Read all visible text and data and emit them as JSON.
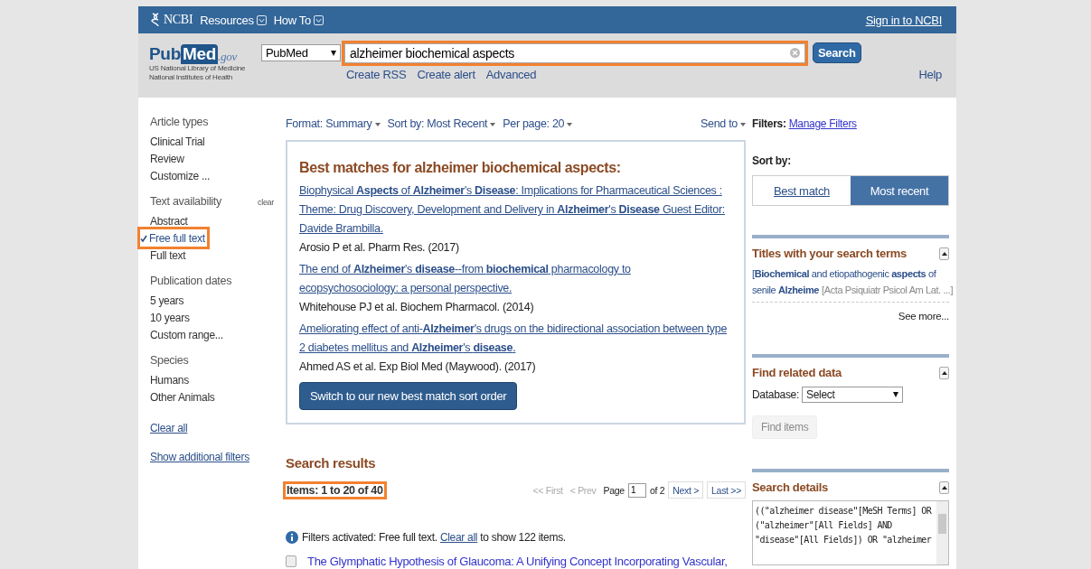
{
  "header": {
    "logo": "NCBI",
    "menus": [
      {
        "label": "Resources"
      },
      {
        "label": "How To"
      }
    ],
    "sign_in": "Sign in to NCBI"
  },
  "search_bar": {
    "logo_pub": "Pub",
    "logo_med": "Med",
    "logo_gov": ".gov",
    "org_lines": [
      "US National Library of Medicine",
      "National Institutes of Health"
    ],
    "database": "PubMed",
    "query": "alzheimer biochemical aspects",
    "highlighted": true,
    "search_button": "Search",
    "links": [
      "Create RSS",
      "Create alert",
      "Advanced"
    ],
    "help": "Help"
  },
  "sidebar": {
    "groups": [
      {
        "title": "Article types",
        "items": [
          {
            "label": "Clinical Trial",
            "checked": false,
            "highlighted": false
          },
          {
            "label": "Review",
            "checked": false,
            "highlighted": false
          },
          {
            "label": "Customize ...",
            "checked": false,
            "highlighted": false
          }
        ]
      },
      {
        "title": "Text availability",
        "clear": "clear",
        "items": [
          {
            "label": "Abstract",
            "checked": false,
            "highlighted": false
          },
          {
            "label": "Free full text",
            "checked": true,
            "highlighted": true
          },
          {
            "label": "Full text",
            "checked": false,
            "highlighted": false
          }
        ]
      },
      {
        "title": "Publication dates",
        "items": [
          {
            "label": "5 years",
            "checked": false,
            "highlighted": false
          },
          {
            "label": "10 years",
            "checked": false,
            "highlighted": false
          },
          {
            "label": "Custom range...",
            "checked": false,
            "highlighted": false
          }
        ]
      },
      {
        "title": "Species",
        "items": [
          {
            "label": "Humans",
            "checked": false,
            "highlighted": false
          },
          {
            "label": "Other Animals",
            "checked": false,
            "highlighted": false
          }
        ]
      }
    ],
    "links": [
      "Clear all",
      "Show additional filters"
    ]
  },
  "toolbar": {
    "menus": [
      {
        "label": "Format: Summary"
      },
      {
        "label": "Sort by: Most Recent"
      },
      {
        "label": "Per page: 20"
      }
    ],
    "send_to": "Send to"
  },
  "best_matches": {
    "title": "Best matches for alzheimer biochemical aspects:",
    "results": [
      {
        "title": "Biophysical **Aspects** of **Alzheimer**'s **Disease**: Implications for Pharmaceutical Sciences : Theme: Drug Discovery, Development and Delivery in **Alzheimer**'s **Disease** Guest Editor: Davide Brambilla.",
        "citation": "Arosio P et al. Pharm Res. (2017)"
      },
      {
        "title": "The end of **Alzheimer**'s **disease**--from **biochemical** pharmacology to ecopsychosociology: a personal perspective.",
        "citation": "Whitehouse PJ et al. Biochem Pharmacol. (2014)"
      },
      {
        "title": "Ameliorating effect of anti-**Alzheimer**'s drugs on the bidirectional association between type 2 diabetes mellitus and **Alzheimer**'s **disease**.",
        "citation": "Ahmed AS et al. Exp Biol Med (Maywood). (2017)"
      }
    ],
    "button": "Switch to our new best match sort order"
  },
  "search_results": {
    "title": "Search results",
    "count": "Items: 1 to 20 of 40",
    "count_highlighted": true,
    "pager": {
      "first": {
        "label": "<< First",
        "disabled": true
      },
      "prev": {
        "label": "< Prev",
        "disabled": true
      },
      "page_label": "Page",
      "page": "1",
      "of": "of 2",
      "next": {
        "label": "Next >",
        "disabled": false
      },
      "last": {
        "label": "Last >>",
        "disabled": false
      }
    },
    "notice": {
      "before": "Filters activated: Free full text.",
      "link": "Clear all",
      "after": "to show 122 items."
    },
    "results": [
      {
        "title": "The Glymphatic Hypothesis of Glaucoma: A Unifying Concept Incorporating Vascular,",
        "checked": false
      }
    ]
  },
  "right": {
    "filters_label": "Filters:",
    "manage_filters": "Manage Filters",
    "sort_label": "Sort by:",
    "sort_options": [
      {
        "label": "Best match",
        "selected": false
      },
      {
        "label": "Most recent",
        "selected": true
      }
    ],
    "titles_panel": {
      "heading": "Titles with your search terms",
      "entry_lines": [
        "[**Biochemical** and etiopathogenic **aspects** of",
        "senile **Alzheime**"
      ],
      "source": "[Acta Psiquiatr Psicol Am Lat. ...]",
      "see_more": "See more..."
    },
    "related_panel": {
      "heading": "Find related data",
      "database_label": "Database:",
      "database_value": "Select",
      "button": {
        "label": "Find items",
        "disabled": true
      }
    },
    "details_panel": {
      "heading": "Search details",
      "lines": [
        "((\"alzheimer disease\"[MeSH Terms] OR",
        "(\"alzheimer\"[All Fields] AND",
        "\"disease\"[All Fields]) OR \"alzheimer"
      ]
    }
  }
}
